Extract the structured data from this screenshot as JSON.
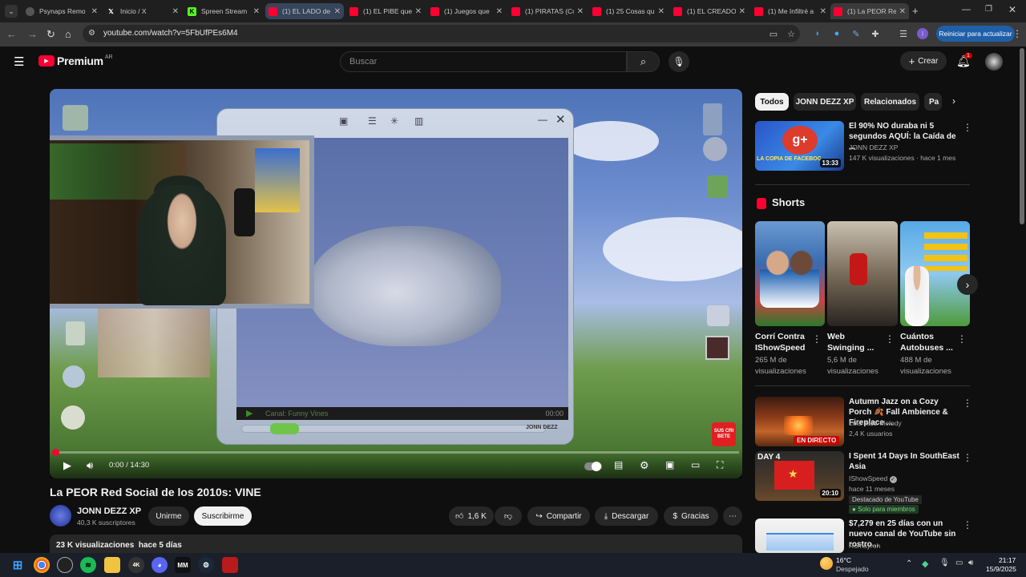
{
  "browser": {
    "tabs": [
      {
        "title": "Psynaps Remo",
        "icon": "psynaps-icon"
      },
      {
        "title": "Inicio / X",
        "icon": "x-icon"
      },
      {
        "title": "Spreen Stream",
        "icon": "kick-icon"
      },
      {
        "title": "(1) EL LADO de",
        "icon": "youtube-icon"
      },
      {
        "title": "(1) EL PIBE que",
        "icon": "youtube-icon"
      },
      {
        "title": "(1) Juegos que",
        "icon": "youtube-icon"
      },
      {
        "title": "(1) PIRATAS (Co",
        "icon": "youtube-icon"
      },
      {
        "title": "(1) 25 Cosas qu",
        "icon": "youtube-icon"
      },
      {
        "title": "(1) EL CREADO",
        "icon": "youtube-icon"
      },
      {
        "title": "(1) Me Infiltré a",
        "icon": "youtube-icon"
      },
      {
        "title": "(1) La PEOR Re",
        "icon": "youtube-icon"
      }
    ],
    "url": "youtube.com/watch?v=5FbUfPEs6M4",
    "restart_label": "Reiniciar para actualizar"
  },
  "yt": {
    "logo": "Premium",
    "region": "AR",
    "search_placeholder": "Buscar",
    "create_label": "Crear",
    "notif_count": "1"
  },
  "video": {
    "overlay_channel": "Canal: Funny Vines",
    "overlay_time": "00:00",
    "overlay_brand": "JONN DEZZ",
    "overlay_sub": "SUS CRI BETE",
    "time": "0:00 / 14:30",
    "progress_fraction": 0.005,
    "title": "La PEOR Red Social de los 2010s: VINE",
    "channel": "JONN DEZZ XP",
    "subs": "40,3 K suscriptores",
    "join_label": "Unirme",
    "subscribe_label": "Suscribirme",
    "likes": "1,6 K",
    "share_label": "Compartir",
    "download_label": "Descargar",
    "thanks_label": "Gracias",
    "desc_views": "23 K visualizaciones",
    "desc_date": "hace 5 días"
  },
  "chips": [
    "Todos",
    "JONN DEZZ XP",
    "Relacionados",
    "Pa"
  ],
  "rec_top": {
    "title": "El 90% NO duraba ni 5 segundos AQUÍ: la Caída de ...",
    "channel": "JONN DEZZ XP",
    "meta": "147 K visualizaciones · hace 1 mes",
    "duration": "13:33",
    "thumb_text": "LA COPIA DE FACEBOOK"
  },
  "shorts": {
    "heading": "Shorts",
    "items": [
      {
        "title": "Corrí Contra IShowSpeed",
        "views": "265 M de visualizaciones"
      },
      {
        "title": "Web Swinging ...",
        "views": "5,6 M de visualizaciones"
      },
      {
        "title": "Cuántos Autobuses ...",
        "views": "488 M de visualizaciones"
      }
    ]
  },
  "rec_list": [
    {
      "title": "Autumn Jazz on a Cozy Porch 🍂 Fall Ambience & Fireplace ...",
      "channel": "Loid Jazz Melody",
      "meta": "2,4 K usuarios",
      "badge": "EN DIRECTO"
    },
    {
      "title": "I Spent 14 Days In SouthEast Asia",
      "channel": "IShowSpeed",
      "meta": "hace 11 meses",
      "extra": "Destacado de YouTube",
      "extra2": "Solo para miembros",
      "duration": "20:10",
      "thumb_text": "DAY 4"
    },
    {
      "title": "$7,279 en 25 días con un nuevo canal de YouTube sin rostro...",
      "channel": "Romayroh",
      "meta": ""
    }
  ],
  "taskbar": {
    "temp": "16°C",
    "weather": "Despejado",
    "time": "21:17",
    "date": "15/9/2025"
  }
}
